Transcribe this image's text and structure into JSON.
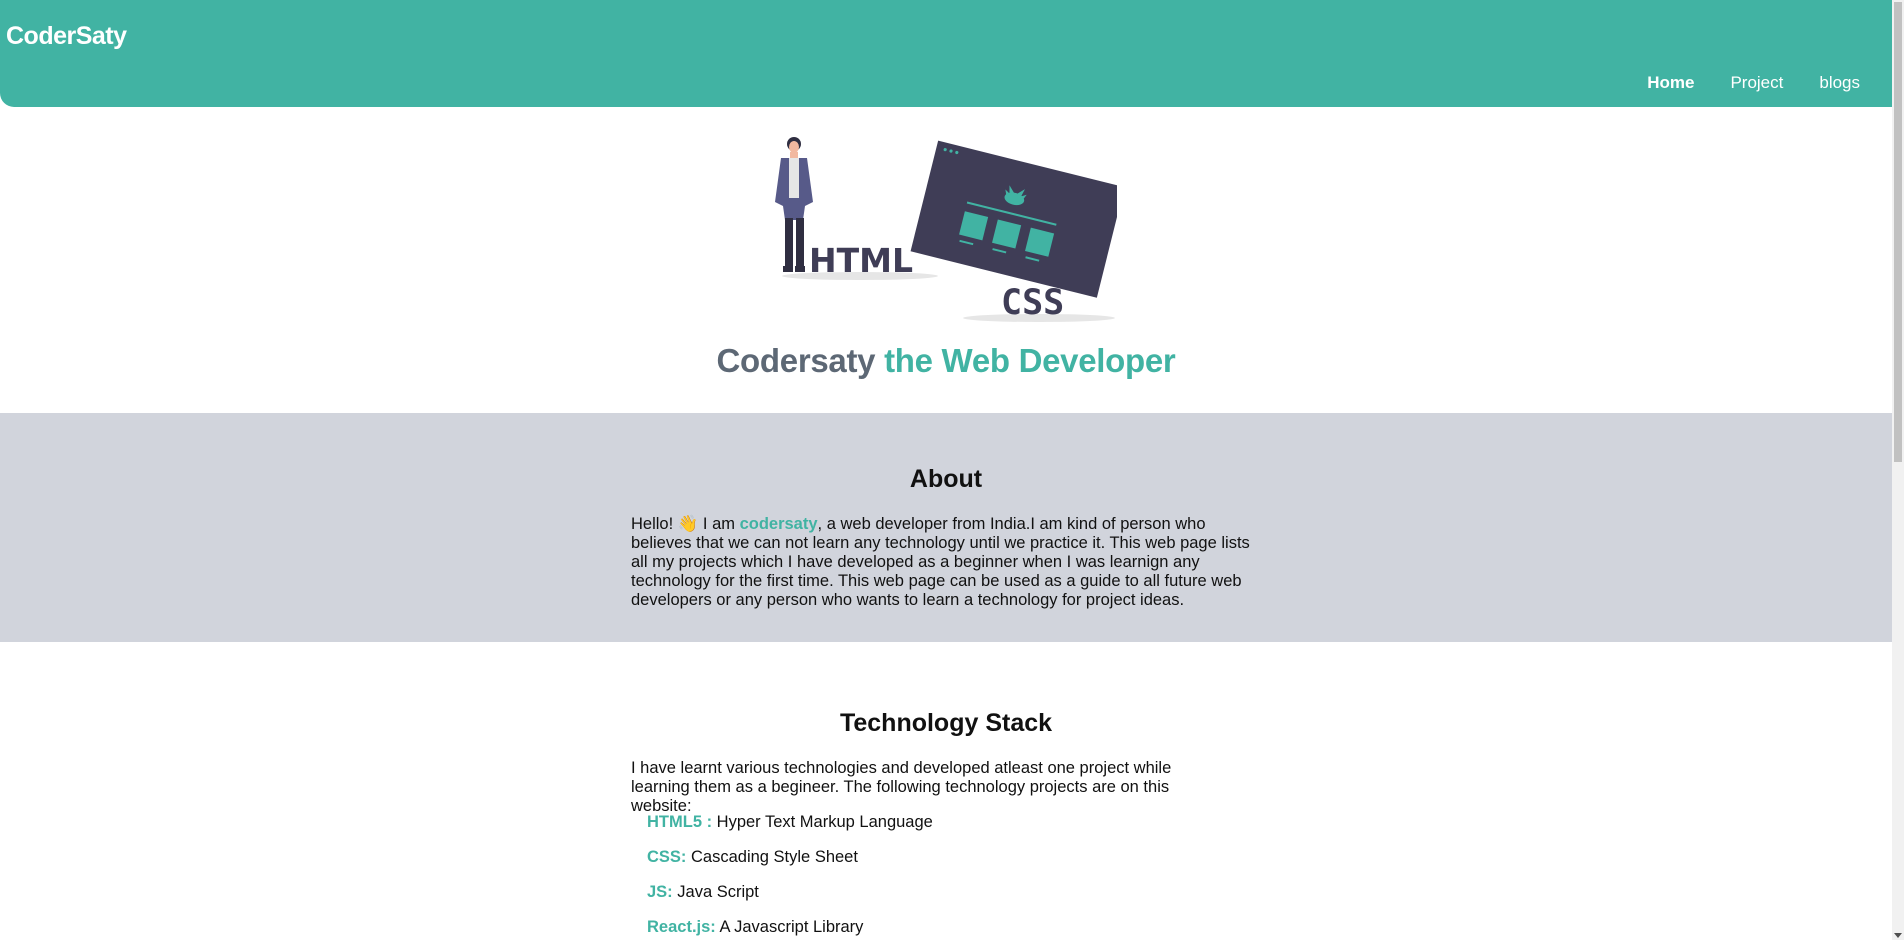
{
  "header": {
    "brand": "CoderSaty",
    "nav": [
      {
        "label": "Home"
      },
      {
        "label": "Project"
      },
      {
        "label": "blogs"
      }
    ]
  },
  "hero": {
    "illustration_text": {
      "html": "HTML",
      "css": "CSS"
    },
    "title_name": "Codersaty",
    "title_role": "the Web Developer"
  },
  "about": {
    "heading": "About",
    "text_start": "Hello! 👋 I am ",
    "highlight": "codersaty",
    "text_end": ", a web developer from India.I am kind of person who believes that we can not learn any technology until we practice it. This web page lists all my projects which I have developed as a beginner when I was learnign any technology for the first time. This web page can be used as a guide to all future web developers or any person who wants to learn a technology for project ideas."
  },
  "tech": {
    "heading": "Technology Stack",
    "intro": "I have learnt various technologies and developed atleast one project while learning them as a begineer. The following technology projects are on this website:",
    "items": [
      {
        "name": "HTML5 :",
        "desc": " Hyper Text Markup Language"
      },
      {
        "name": "CSS:",
        "desc": " Cascading Style Sheet"
      },
      {
        "name": "JS:",
        "desc": " Java Script"
      },
      {
        "name": "React.js:",
        "desc": " A Javascript Library"
      }
    ]
  },
  "colors": {
    "accent": "#41b3a3",
    "about_bg": "#d1d4dc",
    "title_gray": "#5d6875",
    "illustration_dark": "#3f3d56"
  }
}
